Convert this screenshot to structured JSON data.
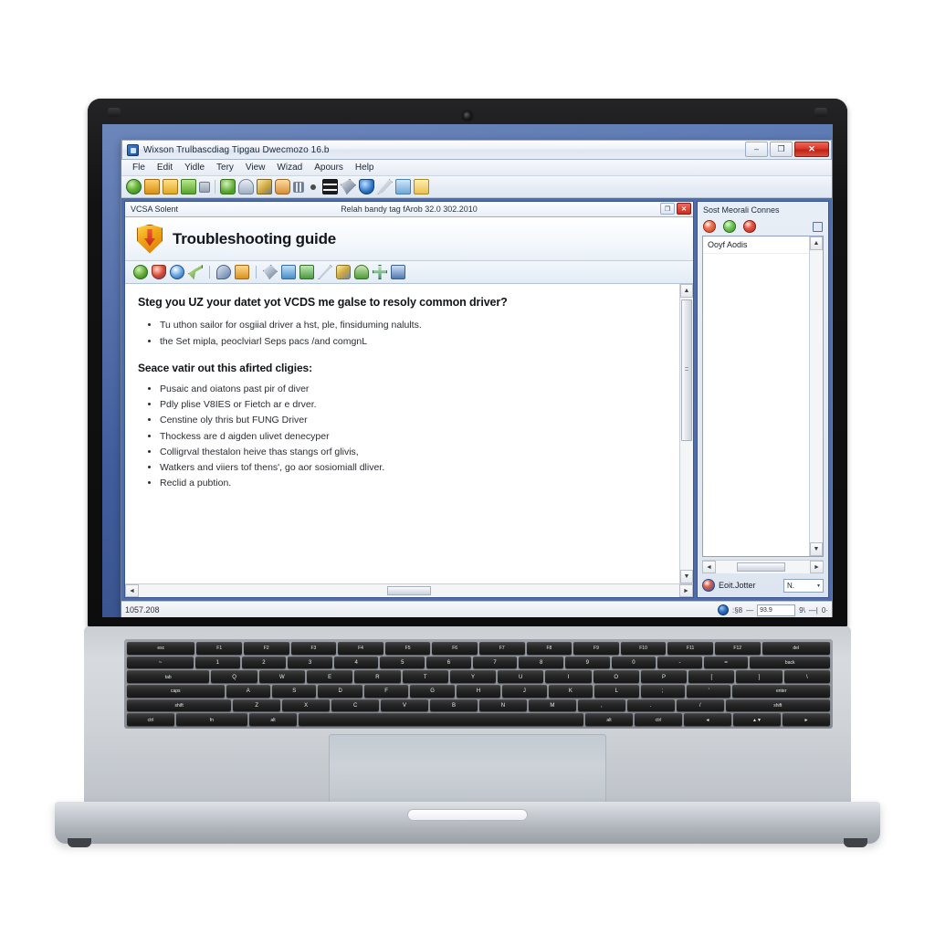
{
  "window": {
    "title": "Wixson Trulbascdiag Tipgau Dwecmozo 16.b",
    "app_icon": "app-window-icon",
    "controls": {
      "minimize": "–",
      "maximize": "❐",
      "close": "✕"
    },
    "menus": [
      "Fle",
      "Edit",
      "Yidle",
      "Tery",
      "View",
      "Wizad",
      "Apours",
      "Help"
    ],
    "toolbar_icons": [
      "globe-icon",
      "open-folder-icon",
      "save-icon",
      "export-icon",
      "pin-icon",
      "download-icon",
      "user-icon",
      "tools-icon",
      "run-person-icon",
      "grid-icon",
      "dot-icon",
      "layers-icon",
      "wrench-icon",
      "shield-check-icon",
      "pen-icon",
      "print-icon",
      "report-icon"
    ]
  },
  "doc_window": {
    "title_left": "VCSA Solent",
    "title_center": "Relah bandy tag fArob 32.0 302.2010",
    "controls": {
      "restore": "❐",
      "close": "✕"
    },
    "header": {
      "icon": "warning-shield-icon",
      "title": "Troubleshooting guide"
    },
    "toolbar_icons": [
      "globe-icon",
      "shield-icon",
      "circle-refresh-icon",
      "key-green-icon",
      "key-icon",
      "lock-folder-icon",
      "magnifier-icon",
      "clipboard-icon",
      "card-icon",
      "pencil-line-icon",
      "cable-icon",
      "user-search-icon",
      "add-marker-icon",
      "chart-icon"
    ],
    "content": {
      "heading1": "Steg you UZ your datet yot VCDS me galse to resoly  common driver?",
      "bullets1": [
        "Tu uthon sailor for osgiial driver a hst, ple, finsiduming nalults.",
        "the Set mipla, peoclviarl Seps pacs /and comgnL"
      ],
      "heading2": "Seace vatir out this afirted cligies:",
      "bullets2": [
        "Pusaic and oiatons past pir of diver",
        "Pdly plise V8IES or Fietch ar e drver.",
        "Censtine oly thris but FUNG Driver",
        "Thockess are d aigden ulivet denecyper",
        "Colligrval thestalon heive thas stangs orf glivis,",
        "Watkers and viiers tof thens', go aor sosiomiall dliver.",
        "Reclid a pubtion."
      ]
    },
    "vscroll": {
      "up": "▲",
      "down": "▼"
    },
    "hscroll": {
      "left": "◄",
      "right": "►"
    }
  },
  "right_panel": {
    "title": "Sost Meorali Connes",
    "icons": [
      "refresh-red-icon",
      "accept-green-icon",
      "reject-red-icon",
      "grid-view-icon"
    ],
    "list_items": [
      "Ooyf Aodis"
    ],
    "hscroll": {
      "left": "◄",
      "right": "►"
    },
    "footer": {
      "icon": "eot-jotter-icon",
      "label": "Eoit.Jotter",
      "combo_value": "N.",
      "combo_caret": "▾"
    }
  },
  "statusbar": {
    "text": "1057.208",
    "globe_icon": "globe-status-icon",
    "marks": [
      ":§8",
      "—"
    ],
    "field_value": "93.9",
    "right_marks": [
      "9\\",
      "—| ",
      "0·"
    ]
  },
  "keyboard": {
    "rows": [
      [
        "esc",
        "F1",
        "F2",
        "F3",
        "F4",
        "F5",
        "F6",
        "F7",
        "F8",
        "F9",
        "F10",
        "F11",
        "F12",
        "del"
      ],
      [
        "~",
        "1",
        "2",
        "3",
        "4",
        "5",
        "6",
        "7",
        "8",
        "9",
        "0",
        "-",
        "=",
        "back"
      ],
      [
        "tab",
        "Q",
        "W",
        "E",
        "R",
        "T",
        "Y",
        "U",
        "I",
        "O",
        "P",
        "[",
        "]",
        "\\"
      ],
      [
        "caps",
        "A",
        "S",
        "D",
        "F",
        "G",
        "H",
        "J",
        "K",
        "L",
        ";",
        "'",
        "enter"
      ],
      [
        "shift",
        "Z",
        "X",
        "C",
        "V",
        "B",
        "N",
        "M",
        ",",
        ".",
        "/",
        "shift"
      ],
      [
        "ctrl",
        "fn",
        "alt",
        "",
        "alt",
        "ctrl",
        "◄",
        "▲▼",
        "►"
      ]
    ]
  },
  "colors": {
    "desktop_blue": "#4e6aa8",
    "window_chrome": "#eef1f7",
    "accent_orange": "#f0a516",
    "close_red": "#cd2d1f",
    "panel_border": "#3a5490"
  }
}
